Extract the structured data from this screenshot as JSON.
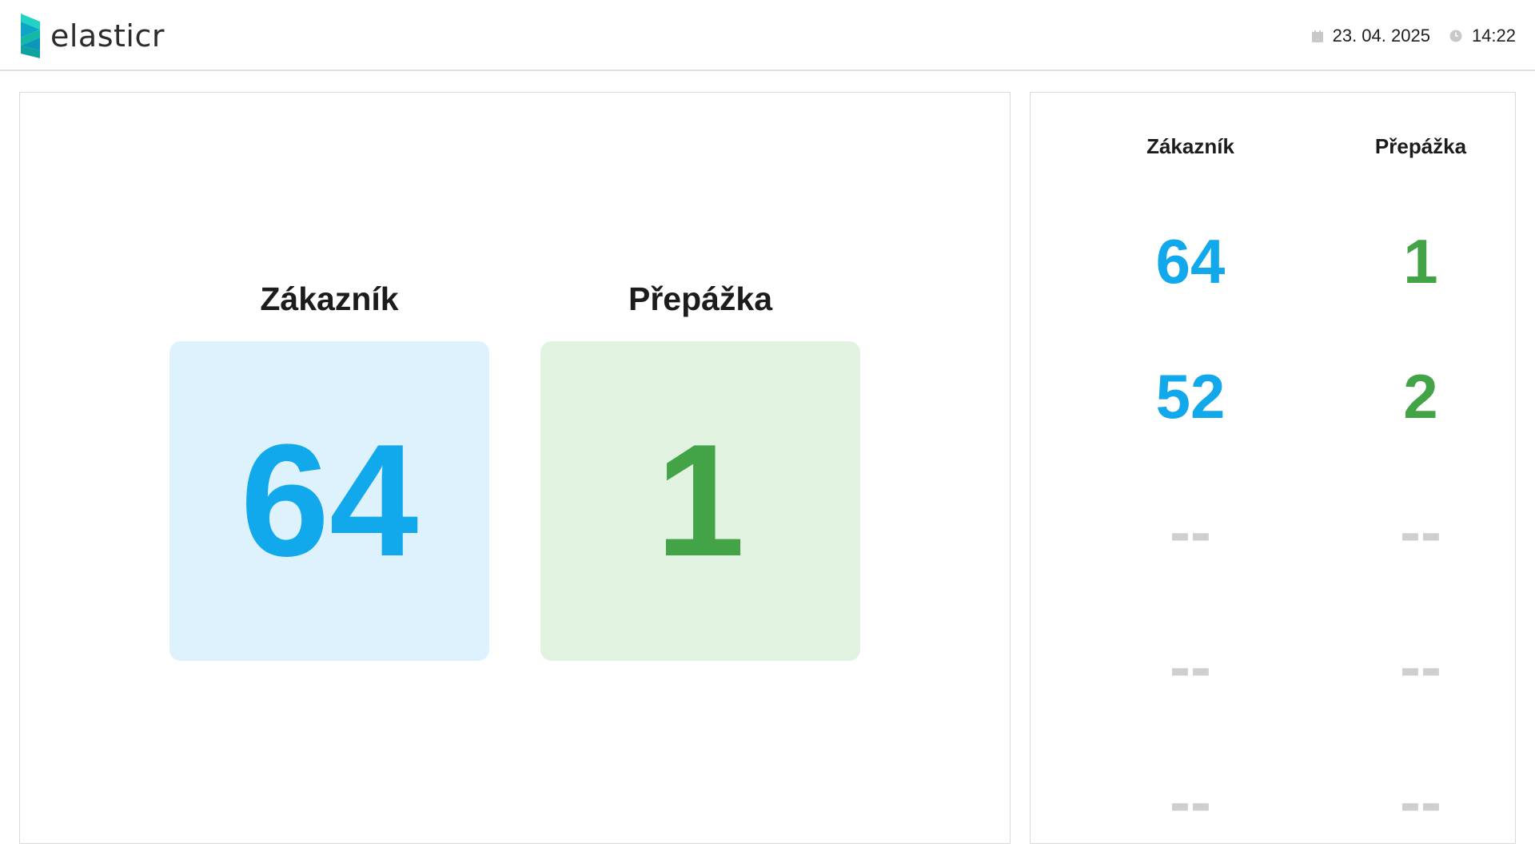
{
  "header": {
    "brand": "elasticr",
    "date": "23. 04. 2025",
    "time": "14:22",
    "icons": {
      "date": "calendar-icon",
      "time": "clock-icon"
    }
  },
  "main": {
    "customer": {
      "label": "Zákazník",
      "value": "64"
    },
    "counter": {
      "label": "Přepážka",
      "value": "1"
    }
  },
  "history": {
    "headers": {
      "customer": "Zákazník",
      "counter": "Přepážka"
    },
    "rows": [
      {
        "customer": "64",
        "counter": "1"
      },
      {
        "customer": "52",
        "counter": "2"
      },
      {
        "customer": "--",
        "counter": "--"
      },
      {
        "customer": "--",
        "counter": "--"
      },
      {
        "customer": "--",
        "counter": "--"
      }
    ]
  },
  "colors": {
    "customer": "#12a9ec",
    "counter": "#43a447",
    "customer_bg": "#ddf2fc",
    "counter_bg": "#e2f2e1",
    "empty": "#cfcfcf",
    "logo": "#1ec8b4"
  }
}
